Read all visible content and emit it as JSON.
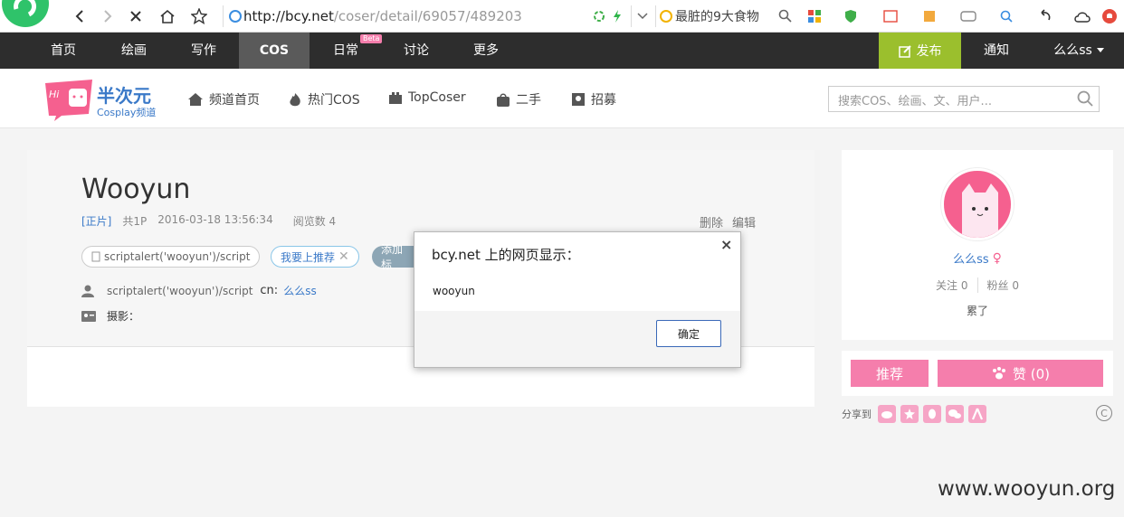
{
  "browser": {
    "url_host": "http://bcy.net",
    "url_path": "/coser/detail/69057/489203",
    "search_text": "最脏的9大食物"
  },
  "nav": {
    "items": [
      "首页",
      "绘画",
      "写作",
      "COS",
      "日常",
      "讨论",
      "更多"
    ],
    "beta_badge": "Beta",
    "publish": "发布",
    "notify": "通知",
    "user": "么么ss"
  },
  "header": {
    "logo_title": "半次元",
    "logo_sub": "Cosplay频道",
    "logo_hi": "Hi",
    "subnav": [
      "频道首页",
      "热门COS",
      "TopCoser",
      "二手",
      "招募"
    ],
    "search_placeholder": "搜索COS、绘画、文、用户..."
  },
  "post": {
    "title": "Wooyun",
    "type": "[正片]",
    "pages": "共1P",
    "date": "2016-03-18 13:56:34",
    "views": "阅览数 4",
    "delete": "删除",
    "edit": "编辑",
    "tag_script": "scriptalert('wooyun')/script",
    "tag_recommend": "我要上推荐",
    "tag_add": "添加标",
    "role": "scriptalert('wooyun')/script",
    "cn_label": "cn:",
    "cn_value": "么么ss",
    "photo_label": "摄影："
  },
  "profile": {
    "name": "么么ss",
    "following": "关注 0",
    "followers": "粉丝 0",
    "status": "累了"
  },
  "actions": {
    "recommend": "推荐",
    "like": "赞 (0)",
    "share_label": "分享到"
  },
  "dialog": {
    "title": "bcy.net 上的网页显示：",
    "message": "wooyun",
    "ok": "确定",
    "close": "×"
  },
  "watermark": "www.wooyun.org",
  "colors": {
    "pink": "#f57eac",
    "green": "#9bbf2d",
    "nav_bg": "#2d2d2d",
    "link": "#3a79c8"
  }
}
